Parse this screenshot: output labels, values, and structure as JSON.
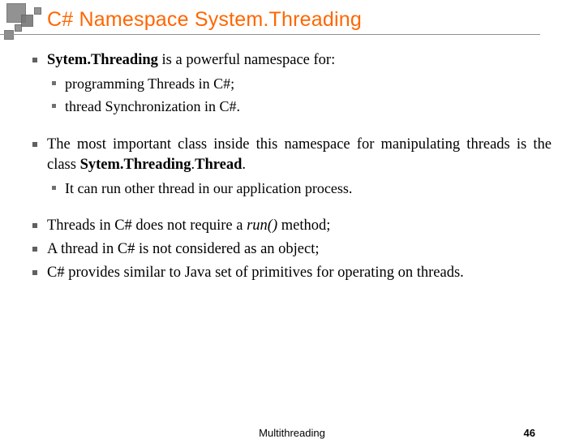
{
  "header": {
    "title": "C# Namespace System.Threading"
  },
  "bullets": {
    "b1_prefix_bold": "Sytem.Threading",
    "b1_rest": " is a powerful namespace  for:",
    "b1_sub1": "programming Threads in C#;",
    "b1_sub2": "thread Synchronization in C#.",
    "b2_pre": "The most important class inside this namespace for manipulating threads is the class ",
    "b2_bold1": "Sytem.Threading",
    "b2_mid": ".",
    "b2_bold2": "Thread",
    "b2_post": ".",
    "b2_sub1": "It can run other thread in our application process.",
    "b3_pre": "Threads in C# does not require a ",
    "b3_ital": "run()",
    "b3_post": " method;",
    "b4": "A thread in C# is not considered as an object;",
    "b5": "C# provides similar to Java set of primitives for operating on threads."
  },
  "footer": {
    "label": "Multithreading",
    "page": "46"
  }
}
